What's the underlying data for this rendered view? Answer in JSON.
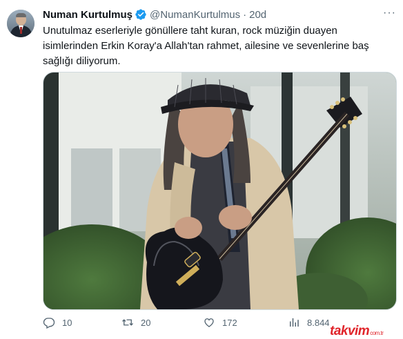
{
  "author": {
    "name": "Numan Kurtulmuş",
    "handle": "@NumanKurtulmus",
    "separator": "·",
    "time": "20d"
  },
  "tweet": {
    "text_lines": [
      "Unutulmaz eserleriyle gönüllere taht kuran, rock müziğin duayen",
      "isimlerinden Erkin Koray'a Allah'tan rahmet, ailesine ve sevenlerine baş",
      "sağlığı diliyorum."
    ]
  },
  "media": {
    "description_icon": "photo-man-with-guitar"
  },
  "actions": {
    "replies": "10",
    "retweets": "20",
    "likes": "172",
    "views": "8.844"
  },
  "watermark": {
    "brand": "takvim",
    "suffix": "com.tr"
  },
  "colors": {
    "verified": "#1d9bf0",
    "secondary_text": "#536471",
    "watermark": "#e0242a"
  }
}
